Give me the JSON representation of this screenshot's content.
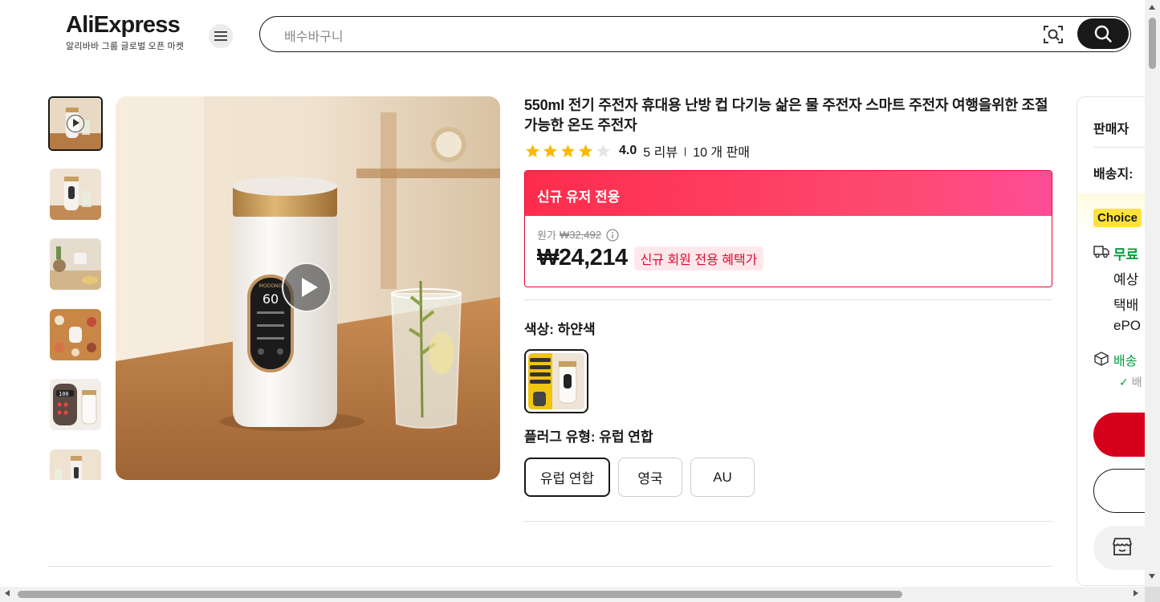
{
  "header": {
    "logo_text": "AliExpress",
    "logo_subtitle": "알리바바 그룹 글로벌 오픈 마켓",
    "search_placeholder": "배수바구니",
    "icons": {
      "menu": "hamburger-icon",
      "lens": "image-search-icon",
      "search": "search-icon"
    }
  },
  "gallery": {
    "thumbnail_count": 6,
    "active_index": 0,
    "first_is_video": true
  },
  "product": {
    "title": "550ml 전기 주전자 휴대용 난방 컵 다기능 삶은 물 주전자 스마트 주전자 여행을위한 조절 가능한 온도 주전자",
    "rating": 4.0,
    "rating_text": "4.0",
    "stars_filled": 4,
    "reviews": "5 리뷰",
    "sold": "10 개 판매",
    "promo": {
      "header": "신규 유저 전용",
      "original_label": "원가",
      "original_price": "₩32,492",
      "price": "₩24,214",
      "badge": "신규 회원 전용 혜택가"
    },
    "color": {
      "label": "색상: 하얀색"
    },
    "plug": {
      "label": "플러그 유형: 유럽 연합",
      "options": [
        "유럽 연합",
        "영국",
        "AU"
      ],
      "selected": 0
    }
  },
  "side_panel": {
    "seller_label": "판매자",
    "ship_to_label": "배송지:",
    "choice_badge": "Choice",
    "free_text": "무료",
    "lines": [
      "예상",
      "택배",
      "ePO"
    ],
    "delivery_label": "배송",
    "check_text": "배"
  },
  "colors": {
    "accent_red": "#e3062c",
    "promo_gradient_start": "#fe2c4c",
    "promo_gradient_end": "#fe4c96",
    "buy_button": "#d6001c",
    "choice_yellow": "#ffe23b",
    "green": "#00a03e"
  }
}
